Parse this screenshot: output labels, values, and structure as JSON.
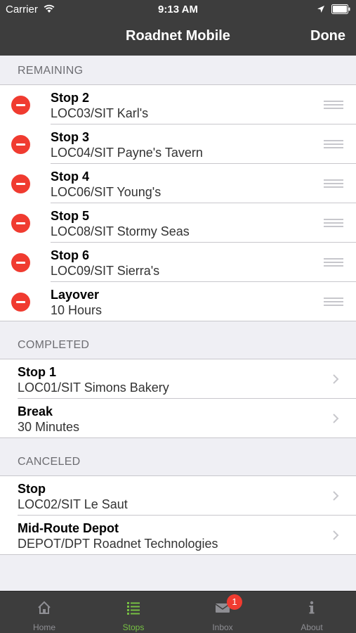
{
  "status_bar": {
    "carrier": "Carrier",
    "time": "9:13 AM"
  },
  "nav": {
    "title": "Roadnet Mobile",
    "done_label": "Done"
  },
  "sections": {
    "remaining": {
      "header": "REMAINING",
      "items": [
        {
          "title": "Stop 2",
          "subtitle": "LOC03/SIT Karl's"
        },
        {
          "title": "Stop 3",
          "subtitle": "LOC04/SIT Payne's Tavern"
        },
        {
          "title": "Stop 4",
          "subtitle": "LOC06/SIT Young's"
        },
        {
          "title": "Stop 5",
          "subtitle": "LOC08/SIT Stormy Seas"
        },
        {
          "title": "Stop 6",
          "subtitle": "LOC09/SIT Sierra's"
        },
        {
          "title": "Layover",
          "subtitle": "10 Hours"
        }
      ]
    },
    "completed": {
      "header": "COMPLETED",
      "items": [
        {
          "title": "Stop 1",
          "subtitle": "LOC01/SIT Simons Bakery"
        },
        {
          "title": "Break",
          "subtitle": "30 Minutes"
        }
      ]
    },
    "canceled": {
      "header": "CANCELED",
      "items": [
        {
          "title": "Stop",
          "subtitle": "LOC02/SIT Le Saut"
        },
        {
          "title": "Mid-Route Depot",
          "subtitle": "DEPOT/DPT Roadnet Technologies"
        }
      ]
    }
  },
  "tabbar": {
    "active_color": "#76c043",
    "items": [
      {
        "label": "Home",
        "icon": "home-icon"
      },
      {
        "label": "Stops",
        "icon": "list-icon"
      },
      {
        "label": "Inbox",
        "icon": "envelope-icon",
        "badge": "1"
      },
      {
        "label": "About",
        "icon": "info-icon"
      }
    ]
  }
}
